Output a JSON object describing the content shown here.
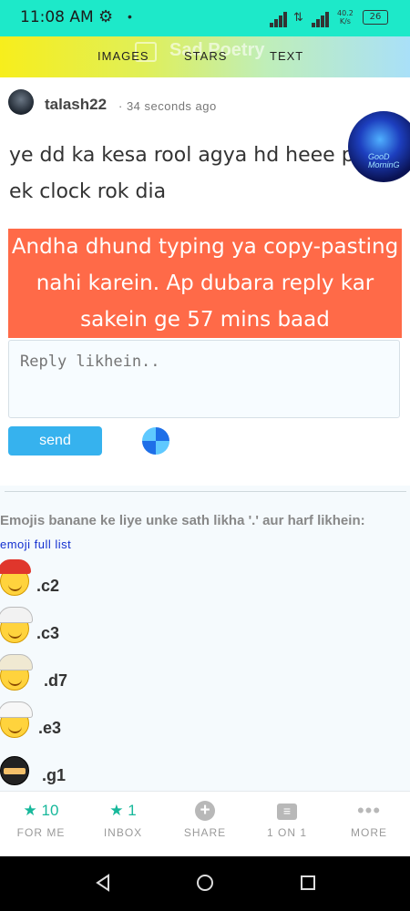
{
  "status_bar": {
    "time": "11:08 AM",
    "net_speed_value": "40.2",
    "net_speed_unit": "K/s",
    "battery": "26"
  },
  "nav": {
    "watermark_title": "Sad Poetry",
    "tabs": [
      "IMAGES",
      "STARS",
      "TEXT"
    ]
  },
  "post": {
    "username": "talash22",
    "time_ago": "· 34 seconds ago",
    "image_text_line1": "GooD",
    "image_text_line2": "MorninG",
    "message": "ye dd ka kesa rool agya hd heee pr ek clock rok dia"
  },
  "warning": "Andha dhund typing ya copy-pasting nahi karein. Ap dubara reply kar sakein ge 57 mins baad",
  "reply": {
    "placeholder": "Reply likhein..",
    "send_label": "send"
  },
  "emoji_section": {
    "hint": "Emojis banane ke liye unke sath likha '.' aur harf likhein:",
    "link_label": "emoji full list",
    "items": [
      {
        "code": ".c2",
        "hat_color": "#e0362c"
      },
      {
        "code": ".c3",
        "hat_color": "#f2f2f2"
      },
      {
        "code": ".d7",
        "hat_color": "#f0e9d2"
      },
      {
        "code": ".e3",
        "hat_color": "#f7f7f7"
      },
      {
        "code": ".g1",
        "hat_color": "#222222"
      }
    ]
  },
  "bottom_nav": {
    "items": [
      {
        "label": "FOR ME",
        "count": "10",
        "icon": "star-icon"
      },
      {
        "label": "INBOX",
        "count": "1",
        "icon": "star-icon"
      },
      {
        "label": "SHARE",
        "icon": "plus-circle-icon"
      },
      {
        "label": "1 ON 1",
        "icon": "chat-icon"
      },
      {
        "label": "MORE",
        "icon": "more-dots-icon"
      }
    ],
    "active_color": "#17b89b"
  },
  "colors": {
    "status_bar": "#1de9c9",
    "warning": "#ff6a48",
    "send_button": "#36b2ee",
    "link": "#1330d0"
  }
}
